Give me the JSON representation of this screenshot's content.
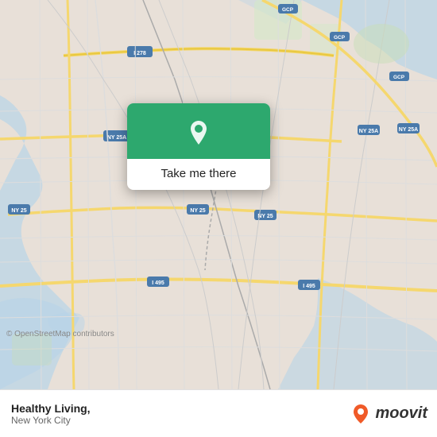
{
  "map": {
    "background_color": "#e8e0d8",
    "attribution": "© OpenStreetMap contributors"
  },
  "popup": {
    "button_label": "Take me there",
    "header_color": "#2da86e",
    "pin_color": "#ffffff"
  },
  "bottom_bar": {
    "title": "Healthy Living,",
    "subtitle": "New York City",
    "moovit_text": "moovit"
  }
}
